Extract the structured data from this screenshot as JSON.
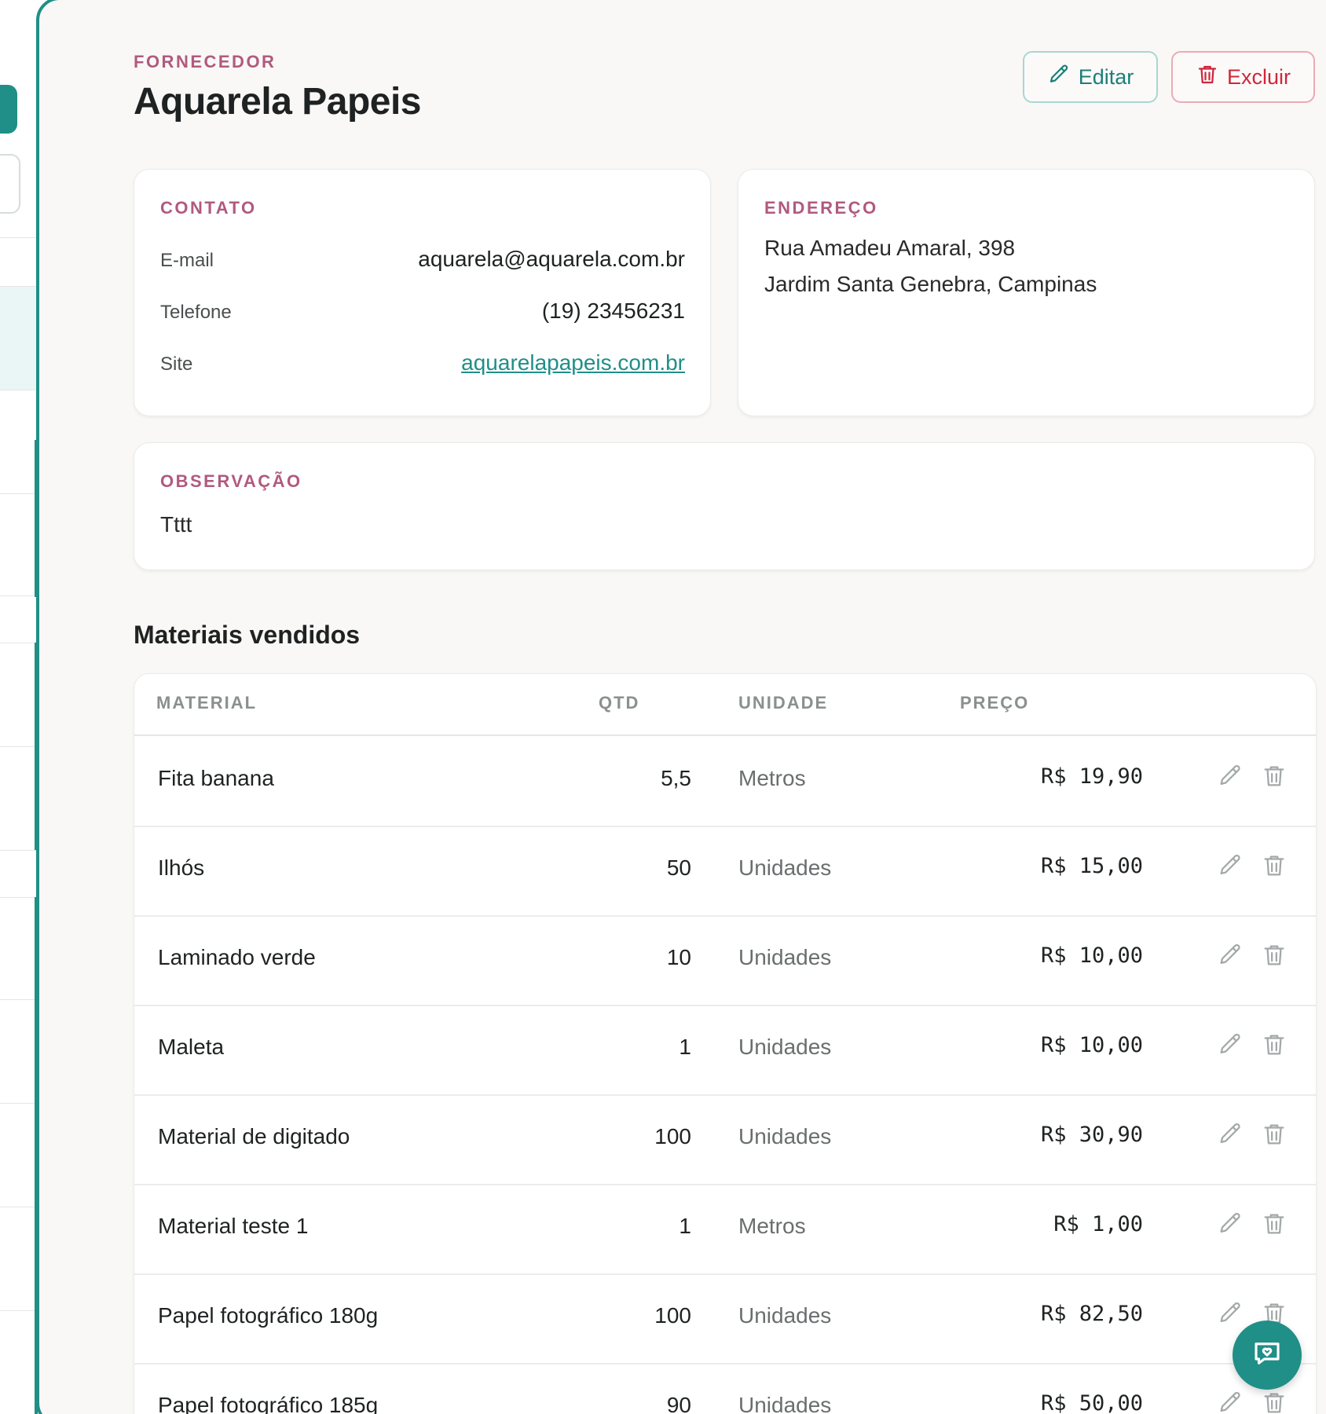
{
  "supplier": {
    "kicker": "FORNECEDOR",
    "name": "Aquarela Papeis"
  },
  "actions": {
    "edit_label": "Editar",
    "delete_label": "Excluir"
  },
  "contact": {
    "label": "CONTATO",
    "email_key": "E-mail",
    "email_value": "aquarela@aquarela.com.br",
    "phone_key": "Telefone",
    "phone_value": "(19) 23456231",
    "site_key": "Site",
    "site_value": "aquarelapapeis.com.br"
  },
  "address": {
    "label": "ENDEREÇO",
    "line1": "Rua Amadeu Amaral, 398",
    "line2": "Jardim Santa Genebra, Campinas"
  },
  "observation": {
    "label": "OBSERVAÇÃO",
    "text": "Tttt"
  },
  "materials": {
    "title": "Materiais vendidos",
    "headers": [
      "MATERIAL",
      "QTD",
      "UNIDADE",
      "PREÇO"
    ],
    "rows": [
      {
        "material": "Fita banana",
        "qty": "5,5",
        "unit": "Metros",
        "price": "R$ 19,90"
      },
      {
        "material": "Ilhós",
        "qty": "50",
        "unit": "Unidades",
        "price": "R$ 15,00"
      },
      {
        "material": "Laminado verde",
        "qty": "10",
        "unit": "Unidades",
        "price": "R$ 10,00"
      },
      {
        "material": "Maleta",
        "qty": "1",
        "unit": "Unidades",
        "price": "R$ 10,00"
      },
      {
        "material": "Material de digitado",
        "qty": "100",
        "unit": "Unidades",
        "price": "R$ 30,90"
      },
      {
        "material": "Material teste 1",
        "qty": "1",
        "unit": "Metros",
        "price": "R$ 1,00"
      },
      {
        "material": "Papel fotográfico 180g",
        "qty": "100",
        "unit": "Unidades",
        "price": "R$ 82,50"
      },
      {
        "material": "Papel fotográfico 185g",
        "qty": "90",
        "unit": "Unidades",
        "price": "R$ 50,00"
      }
    ]
  },
  "colors": {
    "accent": "#1f8f87",
    "kicker": "#b05a7e",
    "danger": "#d0263c"
  },
  "icons": {
    "edit": "pencil-icon",
    "delete": "trash-icon",
    "fab": "chat-heart-icon"
  }
}
